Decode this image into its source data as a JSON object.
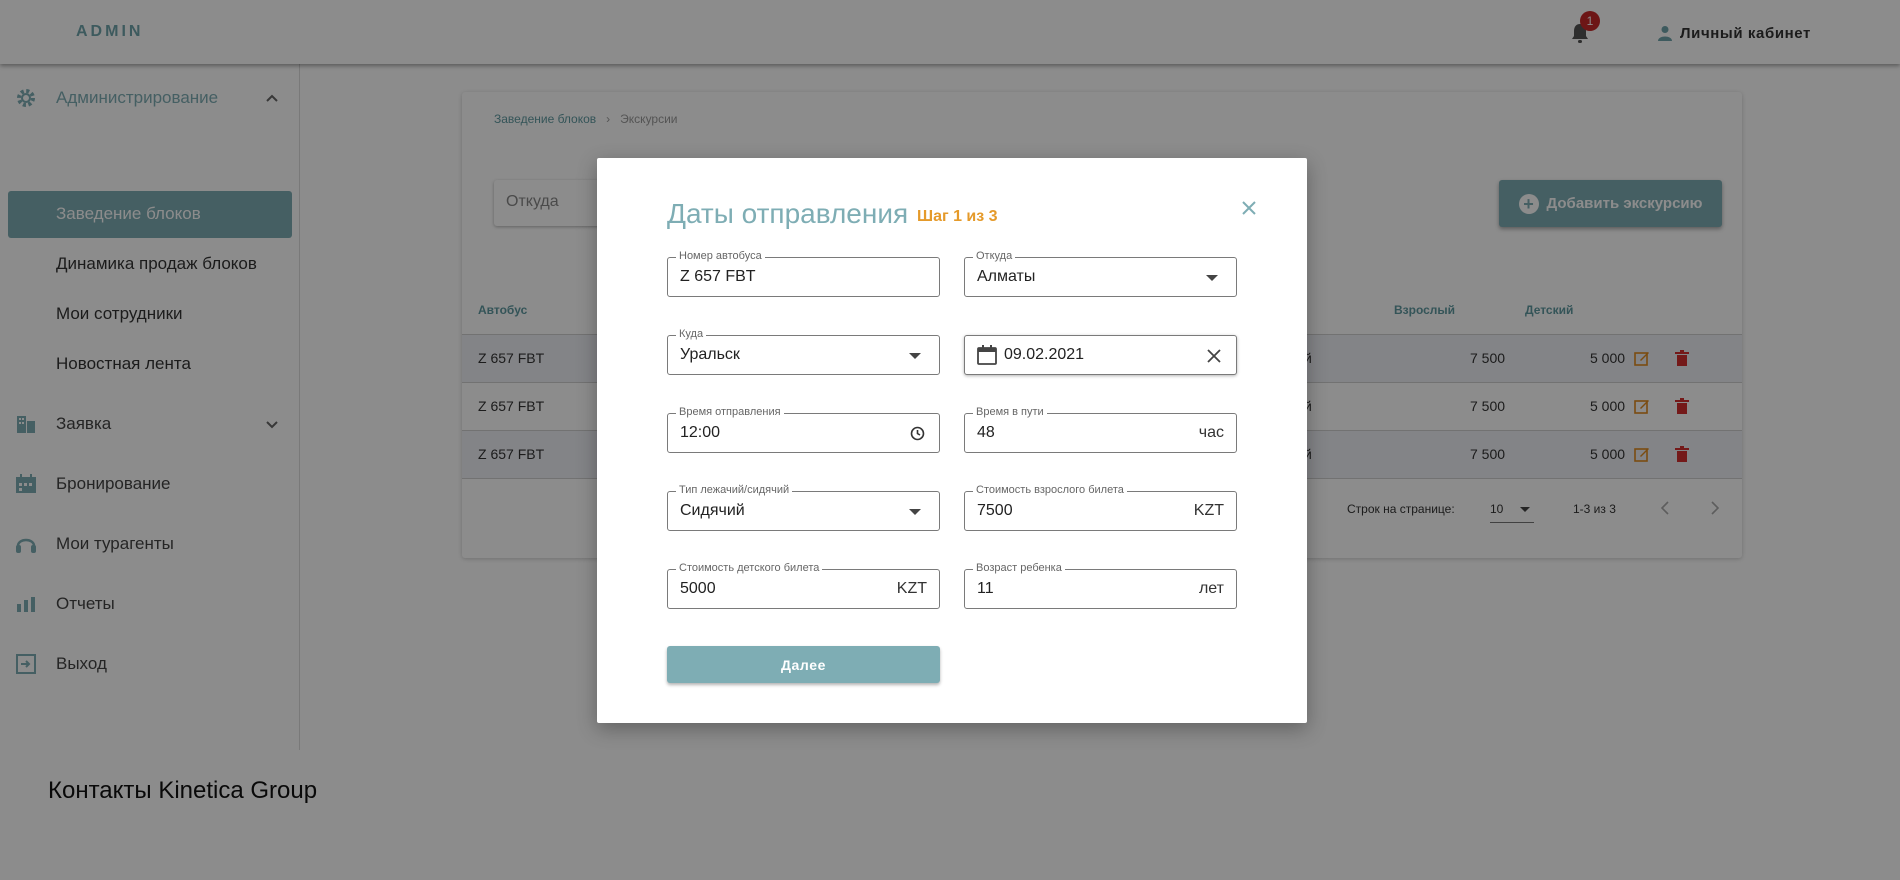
{
  "topbar": {
    "logo": "ADMIN",
    "notifications_count": "1",
    "cabinet_label": "Личный кабинет"
  },
  "sidebar": {
    "admin_label": "Администрирование",
    "sub_items": [
      "Заведение блоков",
      "Динамика продаж блоков",
      "Мои сотрудники",
      "Новостная лента"
    ],
    "items": [
      "Заявка",
      "Бронирование",
      "Мои турагенты",
      "Отчеты",
      "Выход"
    ]
  },
  "breadcrumb": {
    "parent": "Заведение блоков",
    "current": "Экскурсии"
  },
  "filters": {
    "from_placeholder": "Откуда"
  },
  "add_button_label": "Добавить экскурсию",
  "table": {
    "headers": {
      "bus": "Автобус",
      "adult": "Взрослый",
      "child": "Детский"
    },
    "rows": [
      {
        "bus": "Z 657 FBT",
        "partial": "й",
        "adult": "7 500",
        "child": "5 000"
      },
      {
        "bus": "Z 657 FBT",
        "partial": "й",
        "adult": "7 500",
        "child": "5 000"
      },
      {
        "bus": "Z 657 FBT",
        "partial": "й",
        "adult": "7 500",
        "child": "5 000"
      }
    ],
    "rows_per_page_label": "Строк на странице:",
    "rows_per_page_value": "10",
    "range_label": "1-3 из 3"
  },
  "footer": {
    "title": "Контакты Kinetica Group"
  },
  "modal": {
    "title": "Даты отправления",
    "step": "Шаг 1 из 3",
    "fields": {
      "bus_number": {
        "label": "Номер автобуса",
        "value": "Z 657 FBT"
      },
      "from": {
        "label": "Откуда",
        "value": "Алматы"
      },
      "to": {
        "label": "Куда",
        "value": "Уральск"
      },
      "date": {
        "value": "09.02.2021"
      },
      "departure_time": {
        "label": "Время отправления",
        "value": "12:00"
      },
      "travel_time": {
        "label": "Время в пути",
        "value": "48",
        "suffix": "час"
      },
      "seat_type": {
        "label": "Тип лежачий/сидячий",
        "value": "Сидячий"
      },
      "adult_price": {
        "label": "Стоимость взрослого билета",
        "value": "7500",
        "suffix": "KZT"
      },
      "child_price": {
        "label": "Стоимость детского билета",
        "value": "5000",
        "suffix": "KZT"
      },
      "child_age": {
        "label": "Возраст ребенка",
        "value": "11",
        "suffix": "лет"
      }
    },
    "next_label": "Далее"
  },
  "colors": {
    "accent": "#7eadb4",
    "step": "#e59a2a",
    "badge": "#c62828",
    "edit": "#e08a1e",
    "delete": "#d32f2f"
  }
}
